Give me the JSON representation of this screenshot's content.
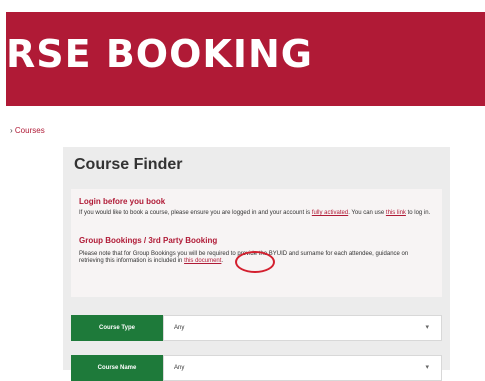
{
  "banner": {
    "title": "RSE BOOKING"
  },
  "breadcrumb": {
    "separator": "›",
    "current": "Courses"
  },
  "course_finder": {
    "title": "Course Finder",
    "login": {
      "heading": "Login before you book",
      "line1": "If you would like to book a course, please ensure you are logged in and your account is",
      "link_account": "fully activated",
      "mid_text": ". You can use",
      "link_here": "this link",
      "end_text": " to log in."
    },
    "group": {
      "heading": "Group Bookings / 3rd Party Booking",
      "text": "Please note that for Group Bookings you will be required to provide the BYUID and surname for each attendee, guidance on retrieving this information is included in",
      "link_doc": "this document",
      "end": "."
    },
    "filters": [
      {
        "label": "Course Type",
        "value": "Any"
      },
      {
        "label": "Course Name",
        "value": "Any"
      }
    ]
  },
  "colors": {
    "brand": "#b01a36",
    "button_green": "#1e7a3a",
    "annotation": "#d31f2e"
  }
}
